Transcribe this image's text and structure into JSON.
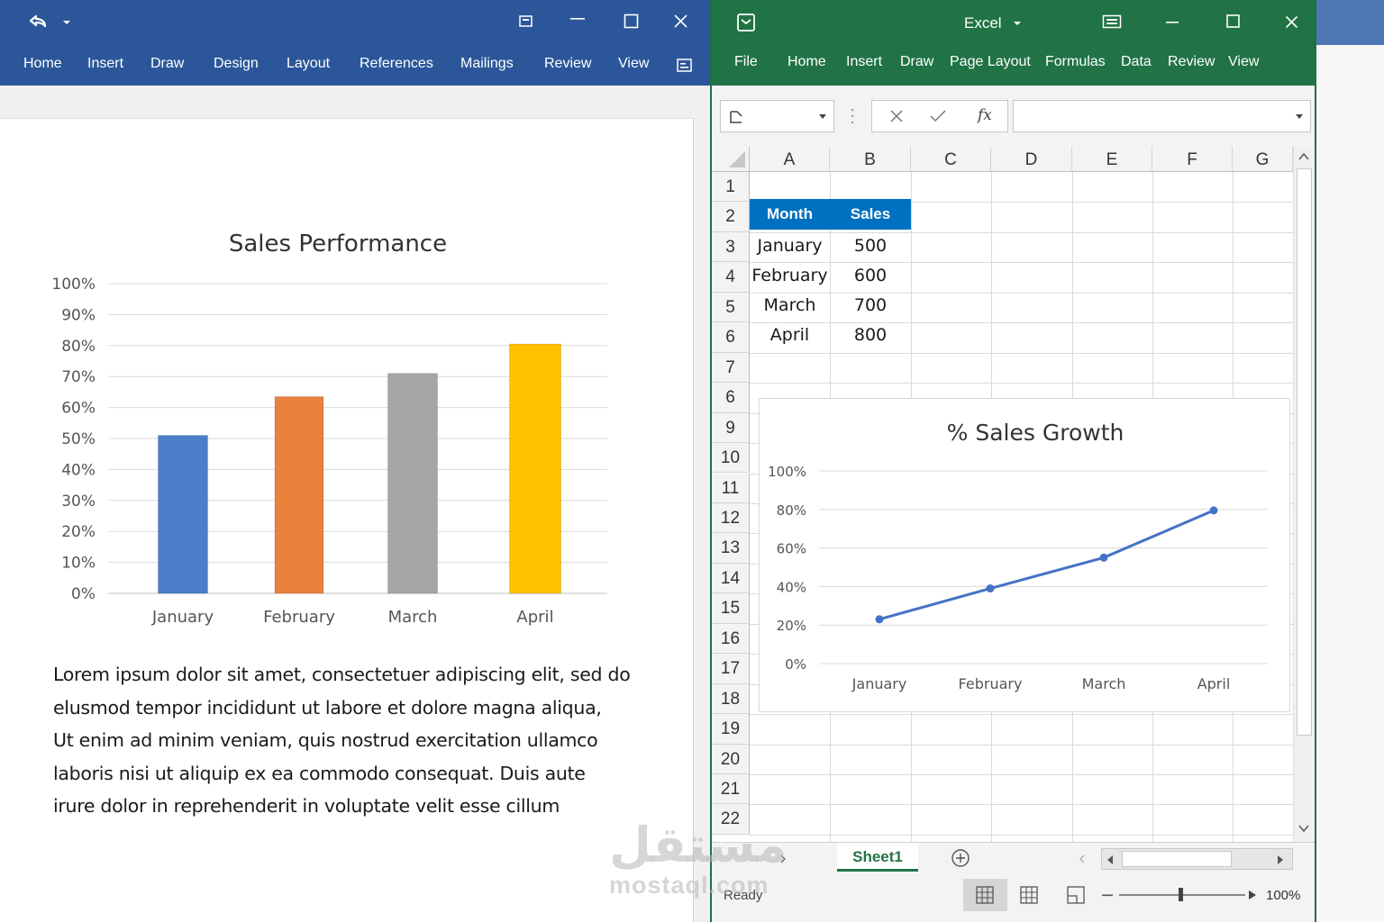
{
  "word": {
    "tabs": [
      "Home",
      "Insert",
      "Draw",
      "Design",
      "Layout",
      "References",
      "Mailings",
      "Review",
      "View"
    ],
    "body_lines": [
      "Lorem ipsum dolor sit amet, consectetuer adipiscing elit, sed do",
      "elusmod tempor incididunt ut labore et dolore magna aliqua,",
      "Ut enim ad minim veniam, quis nostrud exercitation ullamco",
      "laboris nisi ut aliquip ex ea commodo consequat. Duis aute",
      "irure dolor in reprehenderit in voluptate velit esse cillum"
    ]
  },
  "excel": {
    "title": "Excel",
    "tabs": [
      "File",
      "Home",
      "Insert",
      "Draw",
      "Page Layout",
      "Formulas",
      "Data",
      "Review",
      "View"
    ],
    "formula_bar": {
      "fx_label": "fx"
    },
    "columns": [
      "A",
      "B",
      "C",
      "D",
      "E",
      "F",
      "G"
    ],
    "rows": [
      "1",
      "2",
      "3",
      "4",
      "5",
      "6",
      "7",
      "6",
      "9",
      "10",
      "11",
      "12",
      "13",
      "14",
      "15",
      "16",
      "17",
      "18",
      "19",
      "20",
      "21",
      "22"
    ],
    "table": {
      "headers": [
        "Month",
        "Sales"
      ],
      "rows": [
        [
          "January",
          "500"
        ],
        [
          "February",
          "600"
        ],
        [
          "March",
          "700"
        ],
        [
          "April",
          "800"
        ]
      ]
    },
    "sheet_tab": "Sheet1",
    "status": "Ready",
    "zoom": "100%"
  },
  "watermark": {
    "arabic": "مستقل",
    "latin": "mostaql.com"
  },
  "colors": {
    "word_blue": "#2b579a",
    "excel_green": "#217346",
    "table_header": "#0070c0"
  },
  "chart_data": [
    {
      "type": "bar",
      "title": "Sales Performance",
      "categories": [
        "January",
        "February",
        "March",
        "April"
      ],
      "values": [
        0.51,
        0.635,
        0.71,
        0.805
      ],
      "colors": [
        "#4a7ecb",
        "#e8823b",
        "#a5a5a5",
        "#ffc000"
      ],
      "y_ticks": [
        "0%",
        "10%",
        "20%",
        "30%",
        "40%",
        "50%",
        "60%",
        "70%",
        "80%",
        "90%",
        "100%"
      ],
      "ylim": [
        0,
        1
      ],
      "grid": true
    },
    {
      "type": "line",
      "title": "% Sales Growth",
      "categories": [
        "January",
        "February",
        "March",
        "April"
      ],
      "values": [
        0.23,
        0.39,
        0.55,
        0.795
      ],
      "color": "#4472c4",
      "y_ticks": [
        "0%",
        "20%",
        "40%",
        "60%",
        "80%",
        "100%"
      ],
      "ylim": [
        0,
        1
      ],
      "grid": true
    }
  ]
}
